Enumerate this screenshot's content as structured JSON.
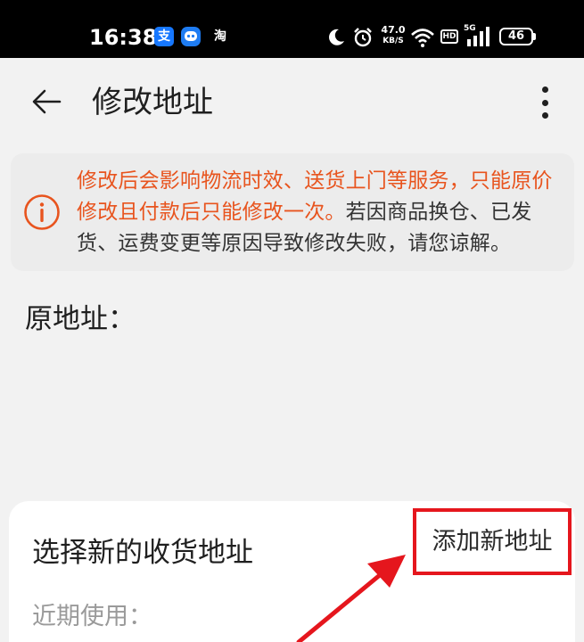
{
  "status_bar": {
    "time": "16:38",
    "alipay_glyph": "支",
    "taobao_glyph": "淘",
    "net_speed_value": "47.0",
    "net_speed_unit": "KB/S",
    "hd_label": "HD",
    "network_label": "5G",
    "battery": "46",
    "icons": [
      "alipay-icon",
      "assistant-icon",
      "taobao-icon",
      "moon-icon",
      "alarm-icon",
      "wifi-icon",
      "signal-icon",
      "battery-icon"
    ]
  },
  "app_bar": {
    "title": "修改地址",
    "back_icon": "arrow-left-icon",
    "more_icon": "more-vertical-icon"
  },
  "notice": {
    "icon": "info-circle-icon",
    "warning_text": "修改后会影响物流时效、送货上门等服务，只能原价修改且付款后只能修改一次。",
    "info_text": "若因商品换仓、已发货、运费变更等原因导致修改失败，请您谅解。",
    "warning_color": "#e8541e"
  },
  "original_address": {
    "label": "原地址："
  },
  "new_address_card": {
    "title": "选择新的收货地址",
    "add_button_label": "添加新地址",
    "recent_label": "近期使用："
  },
  "colors": {
    "highlight_box": "#e5161d",
    "annotation_arrow": "#e5161d"
  }
}
